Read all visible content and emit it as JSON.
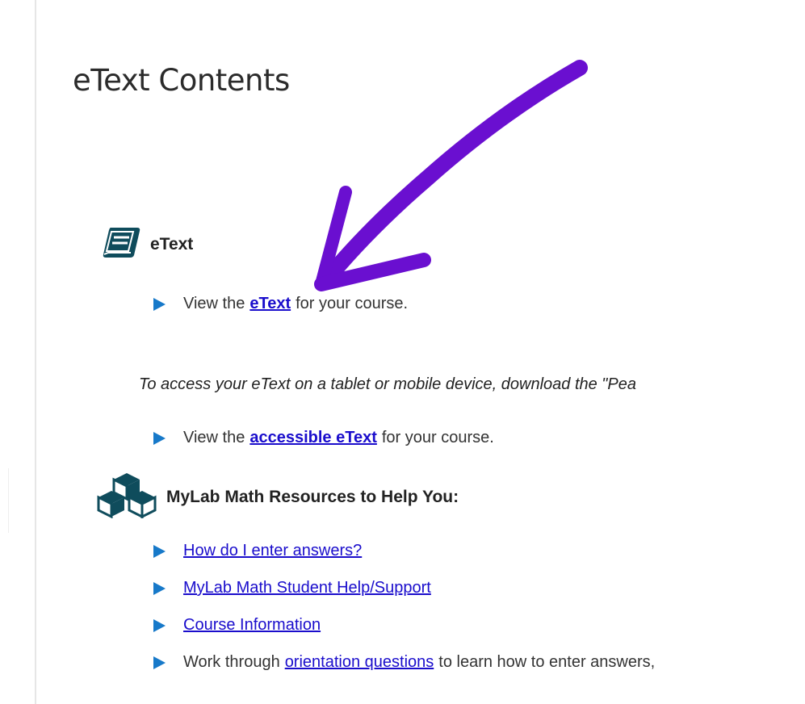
{
  "page": {
    "title": "eText Contents"
  },
  "sections": {
    "etext": {
      "heading": "eText",
      "icon": "book-icon",
      "view": {
        "pre": "View the",
        "link": "eText",
        "post": "for your course."
      },
      "mobile_note": "To access your eText on a tablet or mobile device, download the \"Pea",
      "accessible": {
        "pre": "View the",
        "link": "accessible eText",
        "post": "for your course."
      }
    },
    "resources": {
      "heading": "MyLab Math Resources to Help You:",
      "icon": "cubes-icon",
      "items": [
        {
          "link": "How do I enter answers?"
        },
        {
          "link": "MyLab Math Student Help/Support"
        },
        {
          "link": "Course Information"
        },
        {
          "pre": "Work through",
          "link": "orientation questions",
          "post": "to learn how to enter answers,"
        }
      ]
    }
  },
  "annotation": {
    "icon": "arrow-annotation-icon",
    "color": "#6a0fd0"
  },
  "colors": {
    "link": "#1a0dcc",
    "bullet": "#1779c9",
    "icon": "#0f4c5c"
  }
}
